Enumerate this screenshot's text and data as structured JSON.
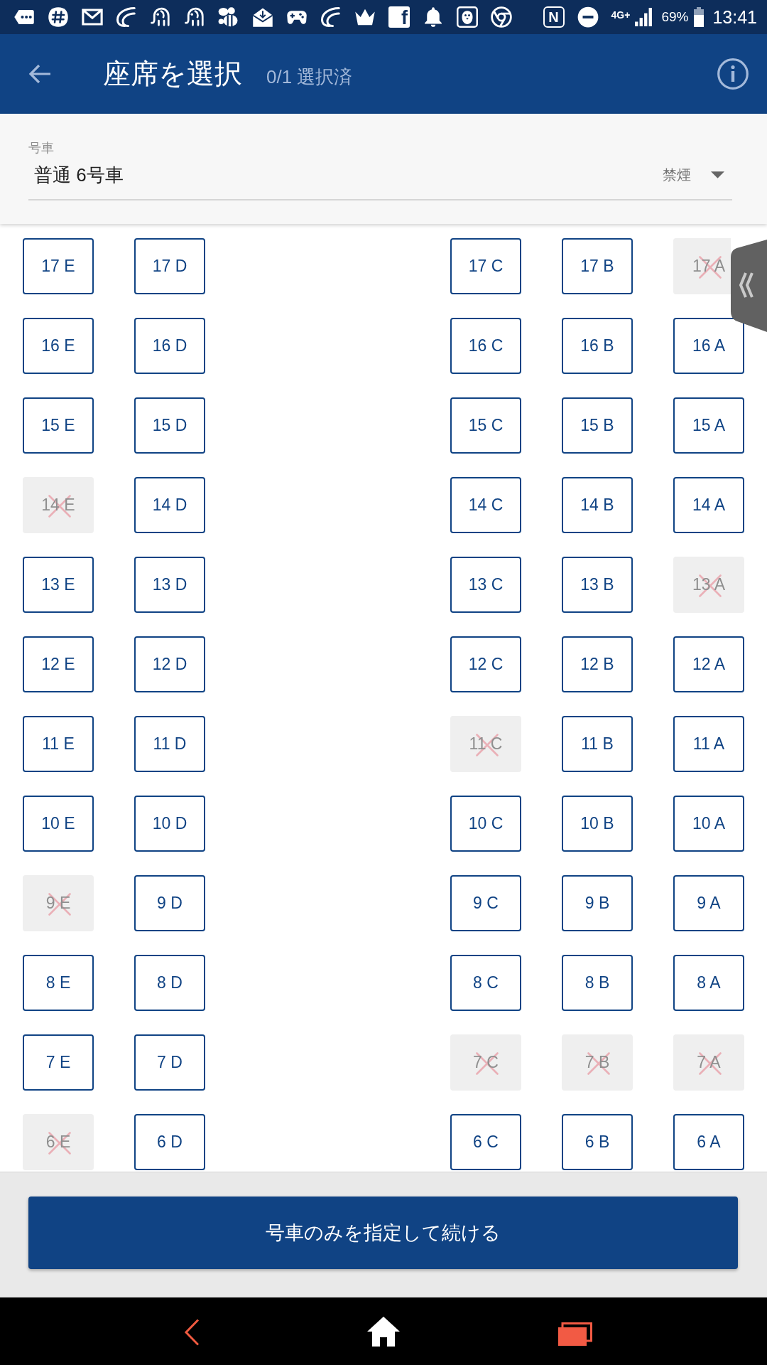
{
  "status_bar": {
    "tile_letter": "f",
    "nfc_letter": "N",
    "network": "4G+",
    "battery": "69%",
    "time": "13:41"
  },
  "header": {
    "title": "座席を選択",
    "selection_count": "0/1 選択済"
  },
  "car_selector": {
    "label": "号車",
    "value": "普通 6号車",
    "smoking": "禁煙"
  },
  "seat_rows": [
    {
      "left": [
        {
          "label": "17 E",
          "available": true
        },
        {
          "label": "17 D",
          "available": true
        }
      ],
      "right": [
        {
          "label": "17 C",
          "available": true
        },
        {
          "label": "17 B",
          "available": true
        },
        {
          "label": "17 A",
          "available": false
        }
      ]
    },
    {
      "left": [
        {
          "label": "16 E",
          "available": true
        },
        {
          "label": "16 D",
          "available": true
        }
      ],
      "right": [
        {
          "label": "16 C",
          "available": true
        },
        {
          "label": "16 B",
          "available": true
        },
        {
          "label": "16 A",
          "available": true
        }
      ]
    },
    {
      "left": [
        {
          "label": "15 E",
          "available": true
        },
        {
          "label": "15 D",
          "available": true
        }
      ],
      "right": [
        {
          "label": "15 C",
          "available": true
        },
        {
          "label": "15 B",
          "available": true
        },
        {
          "label": "15 A",
          "available": true
        }
      ]
    },
    {
      "left": [
        {
          "label": "14 E",
          "available": false
        },
        {
          "label": "14 D",
          "available": true
        }
      ],
      "right": [
        {
          "label": "14 C",
          "available": true
        },
        {
          "label": "14 B",
          "available": true
        },
        {
          "label": "14 A",
          "available": true
        }
      ]
    },
    {
      "left": [
        {
          "label": "13 E",
          "available": true
        },
        {
          "label": "13 D",
          "available": true
        }
      ],
      "right": [
        {
          "label": "13 C",
          "available": true
        },
        {
          "label": "13 B",
          "available": true
        },
        {
          "label": "13 A",
          "available": false
        }
      ]
    },
    {
      "left": [
        {
          "label": "12 E",
          "available": true
        },
        {
          "label": "12 D",
          "available": true
        }
      ],
      "right": [
        {
          "label": "12 C",
          "available": true
        },
        {
          "label": "12 B",
          "available": true
        },
        {
          "label": "12 A",
          "available": true
        }
      ]
    },
    {
      "left": [
        {
          "label": "11 E",
          "available": true
        },
        {
          "label": "11 D",
          "available": true
        }
      ],
      "right": [
        {
          "label": "11 C",
          "available": false
        },
        {
          "label": "11 B",
          "available": true
        },
        {
          "label": "11 A",
          "available": true
        }
      ]
    },
    {
      "left": [
        {
          "label": "10 E",
          "available": true
        },
        {
          "label": "10 D",
          "available": true
        }
      ],
      "right": [
        {
          "label": "10 C",
          "available": true
        },
        {
          "label": "10 B",
          "available": true
        },
        {
          "label": "10 A",
          "available": true
        }
      ]
    },
    {
      "left": [
        {
          "label": "9 E",
          "available": false
        },
        {
          "label": "9 D",
          "available": true
        }
      ],
      "right": [
        {
          "label": "9 C",
          "available": true
        },
        {
          "label": "9 B",
          "available": true
        },
        {
          "label": "9 A",
          "available": true
        }
      ]
    },
    {
      "left": [
        {
          "label": "8 E",
          "available": true
        },
        {
          "label": "8 D",
          "available": true
        }
      ],
      "right": [
        {
          "label": "8 C",
          "available": true
        },
        {
          "label": "8 B",
          "available": true
        },
        {
          "label": "8 A",
          "available": true
        }
      ]
    },
    {
      "left": [
        {
          "label": "7 E",
          "available": true
        },
        {
          "label": "7 D",
          "available": true
        }
      ],
      "right": [
        {
          "label": "7 C",
          "available": false
        },
        {
          "label": "7 B",
          "available": false
        },
        {
          "label": "7 A",
          "available": false
        }
      ]
    },
    {
      "left": [
        {
          "label": "6 E",
          "available": false
        },
        {
          "label": "6 D",
          "available": true
        }
      ],
      "right": [
        {
          "label": "6 C",
          "available": true
        },
        {
          "label": "6 B",
          "available": true
        },
        {
          "label": "6 A",
          "available": true
        }
      ]
    }
  ],
  "continue_button": {
    "label": "号車のみを指定して続ける"
  }
}
